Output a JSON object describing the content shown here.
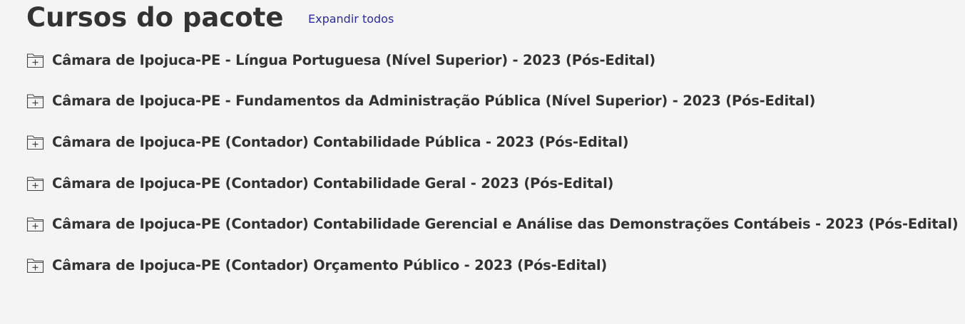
{
  "header": {
    "title": "Cursos do pacote",
    "expand_all_label": "Expandir todos"
  },
  "courses": [
    {
      "title": "Câmara de Ipojuca-PE - Língua Portuguesa (Nível Superior) - 2023 (Pós-Edital)",
      "icon": "folder-plus-icon"
    },
    {
      "title": "Câmara de Ipojuca-PE - Fundamentos da Administração Pública (Nível Superior) - 2023 (Pós-Edital)",
      "icon": "folder-plus-icon"
    },
    {
      "title": "Câmara de Ipojuca-PE (Contador) Contabilidade Pública - 2023 (Pós-Edital)",
      "icon": "folder-plus-icon"
    },
    {
      "title": "Câmara de Ipojuca-PE (Contador) Contabilidade Geral - 2023 (Pós-Edital)",
      "icon": "folder-plus-icon"
    },
    {
      "title": "Câmara de Ipojuca-PE (Contador) Contabilidade Gerencial e Análise das Demonstrações Contábeis - 2023 (Pós-Edital)",
      "icon": "folder-plus-icon"
    },
    {
      "title": "Câmara de Ipojuca-PE (Contador) Orçamento Público - 2023 (Pós-Edital)",
      "icon": "folder-plus-icon"
    }
  ],
  "colors": {
    "background": "#f4f4f4",
    "text": "#333333",
    "link": "#2b2ba3"
  }
}
